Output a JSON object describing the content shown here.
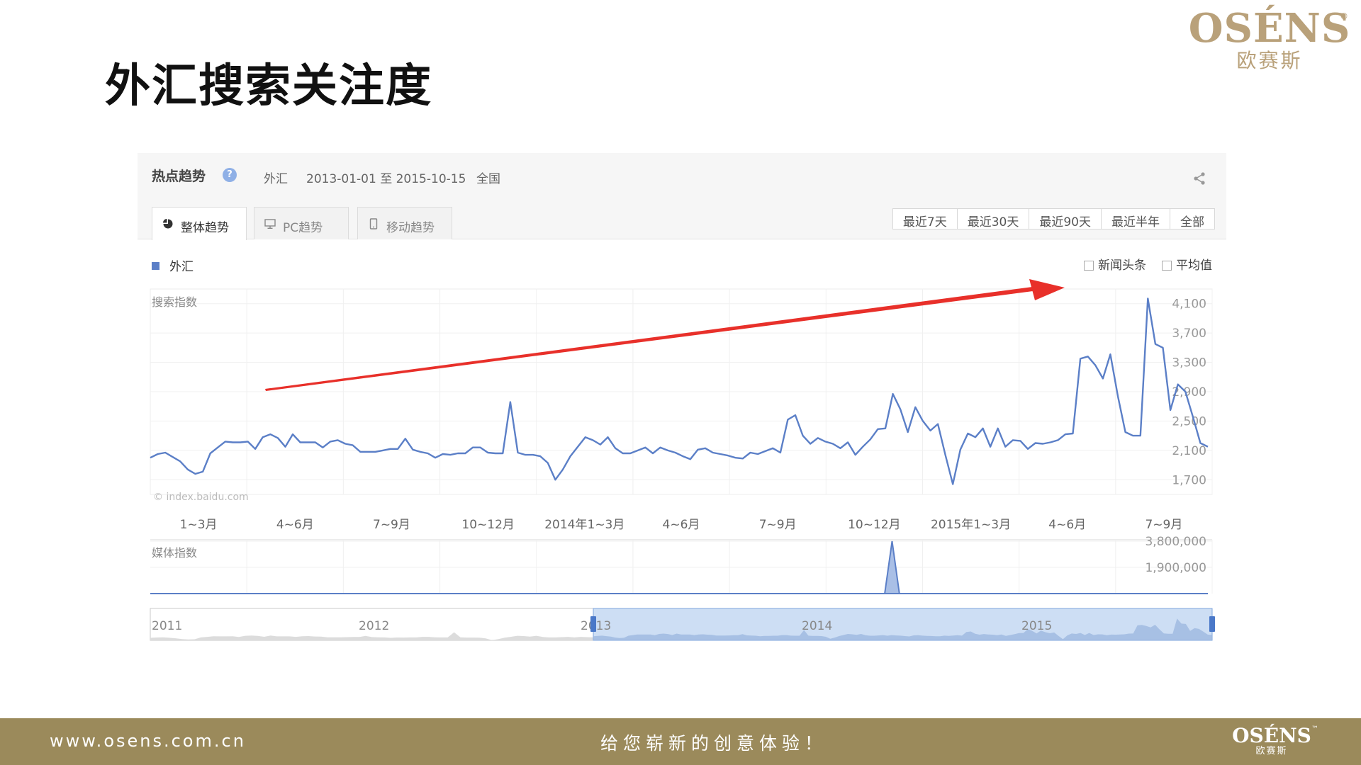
{
  "slide": {
    "title": "外汇搜索关注度",
    "footer_url": "www.osens.com.cn",
    "footer_slogan": "给您崭新的创意体验！"
  },
  "logo": {
    "name": "OSÉNS",
    "sub": "欧赛斯",
    "reg": "®",
    "tm": "™"
  },
  "colors": {
    "brand_gold": "#b9a17a",
    "footer_bg": "#9b8a5b",
    "series_blue": "#5b7fc7",
    "arrow_red": "#e8302a"
  },
  "widget": {
    "title": "热点趋势",
    "help_icon": "?",
    "keyword": "外汇",
    "date_range": "2013-01-01 至 2015-10-15",
    "region": "全国",
    "tabs": [
      {
        "label": "整体趋势",
        "icon": "pie-icon",
        "active": true
      },
      {
        "label": "PC趋势",
        "icon": "monitor-icon",
        "active": false
      },
      {
        "label": "移动趋势",
        "icon": "mobile-icon",
        "active": false
      }
    ],
    "ranges": [
      "最近7天",
      "最近30天",
      "最近90天",
      "最近半年",
      "全部"
    ],
    "legend_label": "外汇",
    "checkbox_news": "新闻头条",
    "checkbox_avg": "平均值",
    "watermark": "© index.baidu.com",
    "overview_years": [
      "2011",
      "2012",
      "2013",
      "2014",
      "2015"
    ]
  },
  "chart_data": [
    {
      "type": "line",
      "title": "",
      "ylabel": "搜索指数",
      "ylim": [
        1500,
        4300
      ],
      "yticks": [
        1700,
        2100,
        2500,
        2900,
        3300,
        3700,
        4100
      ],
      "ytick_labels": [
        "1,700",
        "2,100",
        "2,500",
        "2,900",
        "3,300",
        "3,700",
        "4,100"
      ],
      "xtick_labels": [
        "1~3月",
        "4~6月",
        "7~9月",
        "10~12月",
        "2014年1~3月",
        "4~6月",
        "7~9月",
        "10~12月",
        "2015年1~3月",
        "4~6月",
        "7~9月"
      ],
      "series": [
        {
          "name": "外汇",
          "values": [
            2000,
            2050,
            2070,
            2010,
            1950,
            1840,
            1780,
            1810,
            2060,
            2140,
            2220,
            2210,
            2210,
            2220,
            2120,
            2280,
            2320,
            2270,
            2150,
            2320,
            2210,
            2210,
            2210,
            2140,
            2220,
            2240,
            2190,
            2170,
            2080,
            2080,
            2080,
            2100,
            2120,
            2120,
            2260,
            2110,
            2080,
            2060,
            2000,
            2050,
            2040,
            2060,
            2060,
            2140,
            2140,
            2070,
            2060,
            2060,
            2760,
            2070,
            2040,
            2040,
            2020,
            1930,
            1700,
            1840,
            2020,
            2150,
            2280,
            2240,
            2180,
            2280,
            2130,
            2060,
            2060,
            2100,
            2140,
            2060,
            2140,
            2100,
            2070,
            2020,
            1980,
            2110,
            2130,
            2070,
            2050,
            2030,
            2000,
            1990,
            2070,
            2050,
            2090,
            2130,
            2070,
            2520,
            2580,
            2300,
            2190,
            2270,
            2220,
            2190,
            2130,
            2210,
            2040,
            2150,
            2250,
            2390,
            2400,
            2870,
            2660,
            2350,
            2690,
            2500,
            2370,
            2460,
            2040,
            1640,
            2110,
            2330,
            2280,
            2400,
            2150,
            2400,
            2150,
            2240,
            2230,
            2120,
            2200,
            2190,
            2210,
            2240,
            2320,
            2330,
            3350,
            3380,
            3260,
            3080,
            3410,
            2840,
            2350,
            2300,
            2300,
            4170,
            3550,
            3500,
            2650,
            3000,
            2900,
            2560,
            2200,
            2150
          ],
          "color": "#5b7fc7"
        }
      ],
      "annotation": "upward red trend arrow"
    },
    {
      "type": "area",
      "title": "",
      "ylabel": "媒体指数",
      "ylim": [
        0,
        3800000
      ],
      "yticks": [
        1900000,
        3800000
      ],
      "ytick_labels": [
        "1,900,000",
        "3,800,000"
      ],
      "series": [
        {
          "name": "",
          "values": [
            0,
            0,
            0,
            0,
            0,
            0,
            0,
            0,
            0,
            0,
            0,
            0,
            0,
            0,
            0,
            0,
            0,
            0,
            0,
            0,
            0,
            0,
            0,
            0,
            0,
            0,
            0,
            0,
            0,
            0,
            0,
            0,
            0,
            0,
            0,
            0,
            0,
            0,
            0,
            0,
            0,
            0,
            0,
            0,
            0,
            0,
            0,
            0,
            0,
            0,
            0,
            0,
            0,
            0,
            0,
            0,
            0,
            0,
            0,
            0,
            0,
            0,
            0,
            0,
            0,
            0,
            0,
            0,
            0,
            0,
            0,
            0,
            0,
            0,
            0,
            0,
            0,
            0,
            0,
            0,
            0,
            0,
            0,
            0,
            0,
            0,
            0,
            0,
            0,
            0,
            0,
            0,
            0,
            0,
            0,
            0,
            0,
            0,
            0,
            0,
            0,
            3800000,
            0,
            0,
            0,
            0,
            0,
            0,
            0,
            0,
            0,
            0,
            0,
            0,
            0,
            0,
            0,
            0,
            0,
            0,
            0,
            0,
            0,
            0,
            0,
            0,
            0,
            0,
            0,
            0,
            0,
            0,
            0,
            0,
            0,
            0,
            0,
            0,
            0,
            0,
            0,
            0,
            0,
            0,
            0
          ],
          "color": "#5b7fc7"
        }
      ]
    }
  ]
}
